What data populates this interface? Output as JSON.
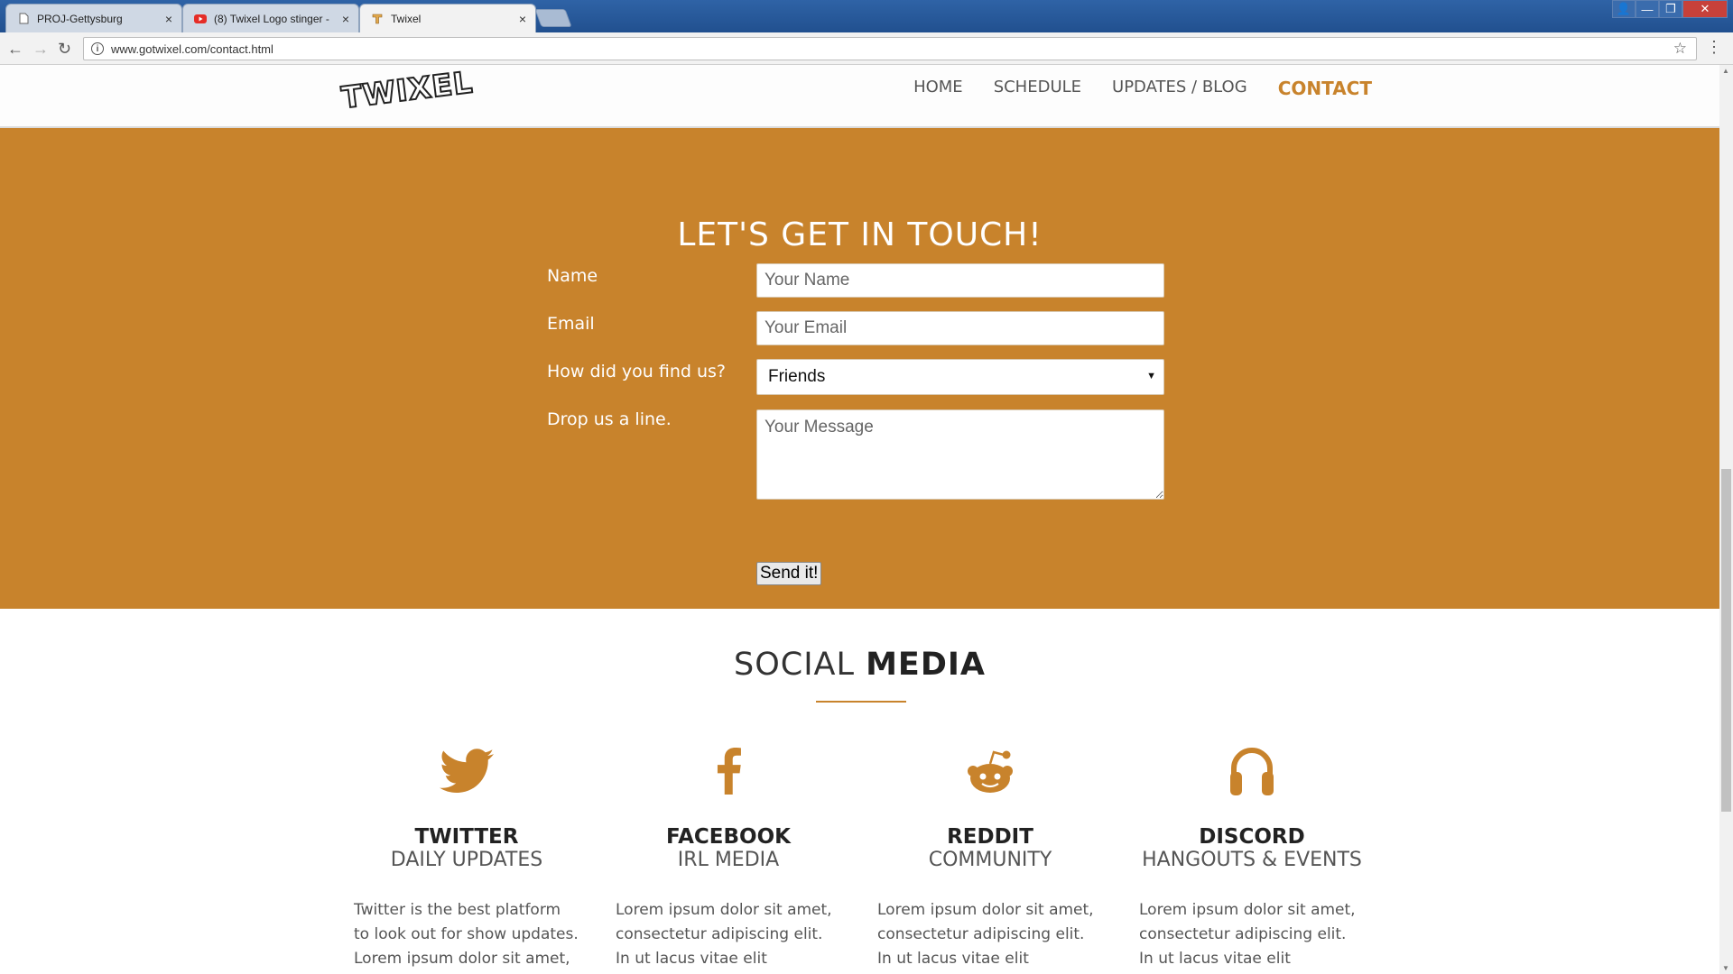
{
  "browser": {
    "tabs": [
      {
        "title": "PROJ-Gettysburg",
        "icon": "page-icon"
      },
      {
        "title": "(8) Twixel Logo stinger -",
        "icon": "youtube-icon"
      },
      {
        "title": "Twixel",
        "icon": "twixel-favicon"
      }
    ],
    "close_glyph": "×",
    "url": "www.gotwixel.com/contact.html",
    "info_glyph": "i",
    "star_glyph": "☆",
    "menu_glyph": "⋮",
    "back_glyph": "←",
    "forward_glyph": "→",
    "reload_glyph": "↻",
    "window_controls": [
      "👤",
      "—",
      "❐",
      "✕"
    ]
  },
  "site": {
    "logo": "TWIXEL",
    "nav": [
      "HOME",
      "SCHEDULE",
      "UPDATES / BLOG",
      "CONTACT"
    ],
    "accent_color": "#c8832c"
  },
  "contact": {
    "heading": "LET'S GET IN TOUCH!",
    "name_label": "Name",
    "name_placeholder": "Your Name",
    "email_label": "Email",
    "email_placeholder": "Your Email",
    "find_label": "How did you find us?",
    "find_value": "Friends",
    "message_label": "Drop us a line.",
    "message_placeholder": "Your Message",
    "send_label": "Send it!"
  },
  "social": {
    "heading_light": "SOCIAL ",
    "heading_bold": "MEDIA",
    "columns": [
      {
        "icon": "twitter-icon",
        "title": "TWITTER",
        "subtitle": "DAILY UPDATES",
        "text": "Twitter is the best platform to look out for show updates. Lorem ipsum dolor sit amet,"
      },
      {
        "icon": "facebook-icon",
        "title": "FACEBOOK",
        "subtitle": "IRL MEDIA",
        "text": "Lorem ipsum dolor sit amet, consectetur adipiscing elit. In ut lacus vitae elit maximus faucibus"
      },
      {
        "icon": "reddit-icon",
        "title": "REDDIT",
        "subtitle": "COMMUNITY",
        "text": "Lorem ipsum dolor sit amet, consectetur adipiscing elit. In ut lacus vitae elit maximus faucibus"
      },
      {
        "icon": "headphones-icon",
        "title": "DISCORD",
        "subtitle": "HANGOUTS & EVENTS",
        "text": "Lorem ipsum dolor sit amet, consectetur adipiscing elit. In ut lacus vitae elit maximus faucibus"
      }
    ]
  }
}
